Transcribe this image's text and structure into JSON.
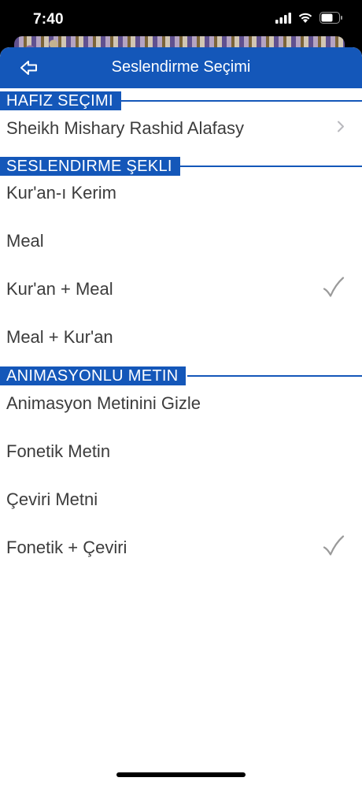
{
  "status_bar": {
    "time": "7:40"
  },
  "nav": {
    "title": "Seslendirme Seçimi"
  },
  "sections": [
    {
      "header": "HAFIZ SEÇIMI",
      "items": [
        {
          "label": "Sheikh Mishary Rashid Alafasy",
          "accessory": "chevron"
        }
      ]
    },
    {
      "header": "SESLENDIRME ŞEKLI",
      "items": [
        {
          "label": "Kur'an-ı Kerim",
          "accessory": "none"
        },
        {
          "label": "Meal",
          "accessory": "none"
        },
        {
          "label": "Kur'an + Meal",
          "accessory": "checkmark"
        },
        {
          "label": "Meal + Kur'an",
          "accessory": "none"
        }
      ]
    },
    {
      "header": "ANIMASYONLU METIN",
      "items": [
        {
          "label": "Animasyon Metinini Gizle",
          "accessory": "none"
        },
        {
          "label": "Fonetik Metin",
          "accessory": "none"
        },
        {
          "label": "Çeviri Metni",
          "accessory": "none"
        },
        {
          "label": "Fonetik + Çeviri",
          "accessory": "checkmark"
        }
      ]
    }
  ],
  "colors": {
    "accent": "#1457b9",
    "text": "#3c3c3c",
    "checkmark": "#9a9a9a"
  },
  "icons": {
    "back": "back-arrow-icon",
    "chevron": "chevron-right-icon",
    "check": "checkmark-icon"
  }
}
